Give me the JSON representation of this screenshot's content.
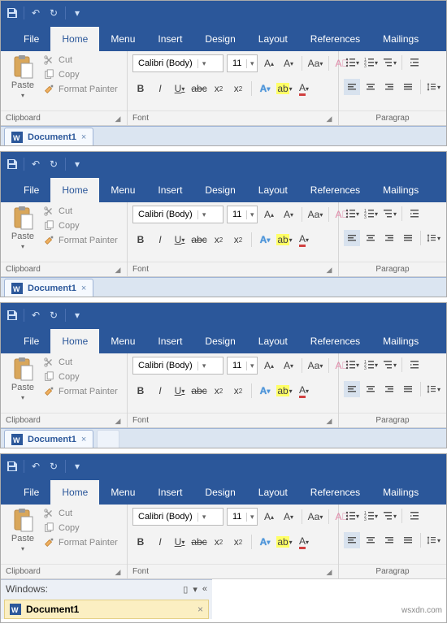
{
  "qat": {
    "items": [
      "save",
      "undo",
      "redo",
      "customize"
    ]
  },
  "tabs": {
    "file": "File",
    "home": "Home",
    "menu": "Menu",
    "insert": "Insert",
    "design": "Design",
    "layout": "Layout",
    "references": "References",
    "mailings": "Mailings"
  },
  "clipboard": {
    "paste": "Paste",
    "cut": "Cut",
    "copy": "Copy",
    "format_painter": "Format Painter",
    "group_label": "Clipboard"
  },
  "font": {
    "name": "Calibri (Body)",
    "size": "11",
    "group_label": "Font"
  },
  "paragraph": {
    "group_label": "Paragrap"
  },
  "doc_tab": {
    "name": "Document1"
  },
  "windows_panel": {
    "header": "Windows:",
    "item": "Document1"
  },
  "watermark": "wsxdn.com"
}
